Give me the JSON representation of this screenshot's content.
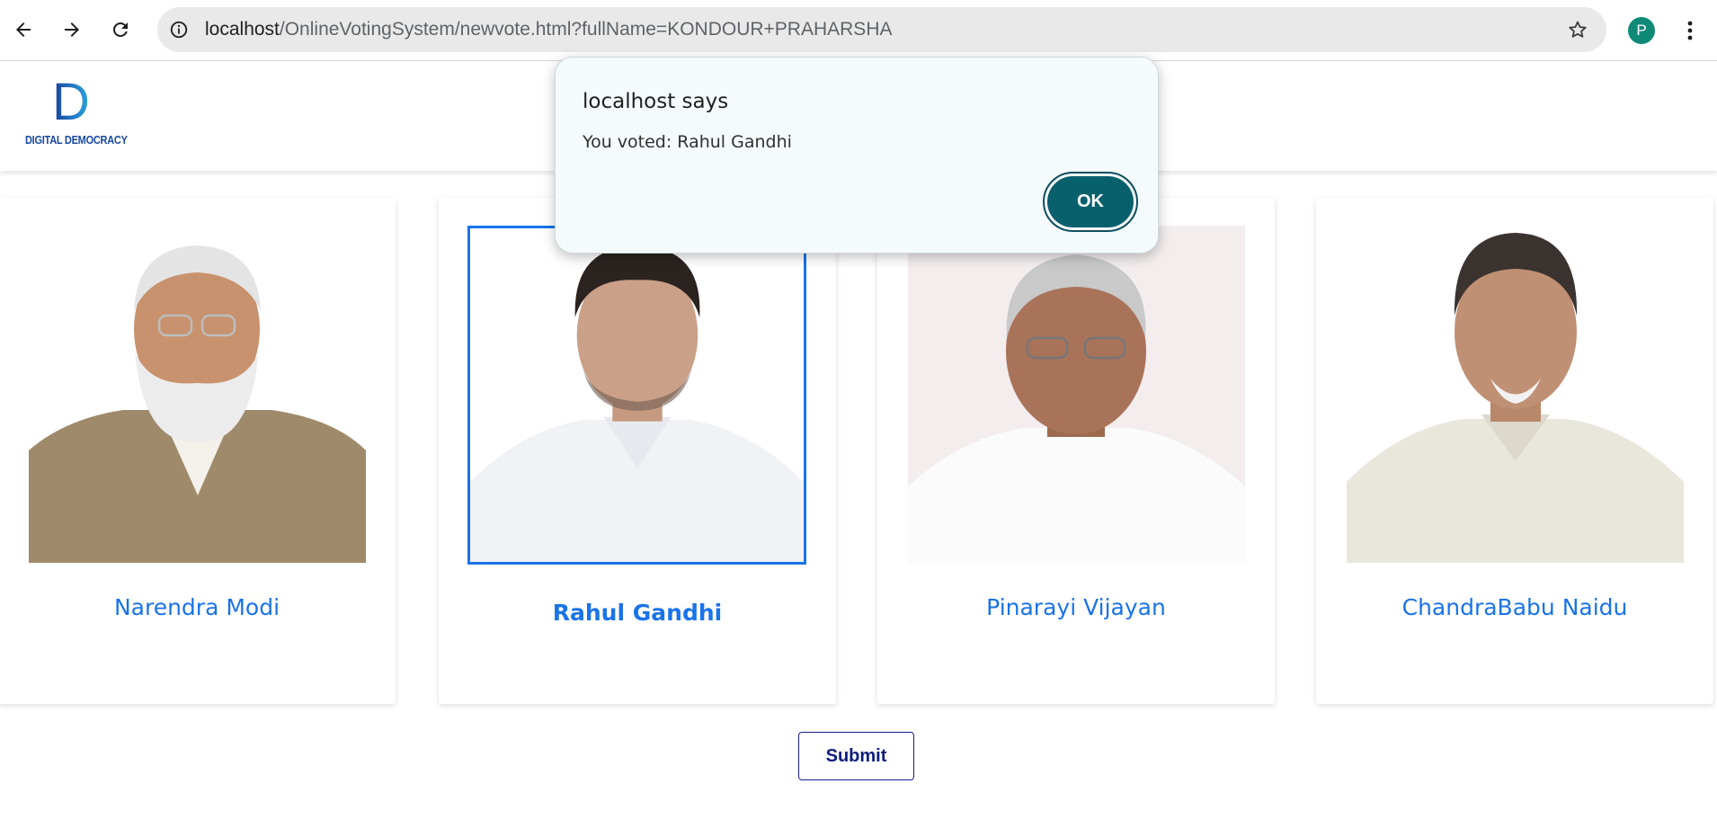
{
  "browser": {
    "url_host": "localhost",
    "url_path": "/OnlineVotingSystem/newvote.html?fullName=KONDOUR+PRAHARSHA",
    "profile_initial": "P",
    "icons": {
      "back": "arrow-left-icon",
      "forward": "arrow-right-icon",
      "reload": "reload-icon",
      "site_info": "info-icon",
      "bookmark": "star-icon",
      "menu": "kebab-menu-icon"
    }
  },
  "header": {
    "logo_letter": "D",
    "logo_text": "DIGITAL DEMOCRACY"
  },
  "candidates": [
    {
      "name": "Narendra Modi",
      "selected": false
    },
    {
      "name": "Rahul Gandhi",
      "selected": true
    },
    {
      "name": "Pinarayi Vijayan",
      "selected": false
    },
    {
      "name": "ChandraBabu Naidu",
      "selected": false
    }
  ],
  "submit_label": "Submit",
  "dialog": {
    "title": "localhost says",
    "message": "You voted: Rahul Gandhi",
    "ok_label": "OK"
  },
  "colors": {
    "accent": "#1a73e8",
    "dialog_button": "#09606d",
    "submit_text": "#0c1c7e"
  }
}
